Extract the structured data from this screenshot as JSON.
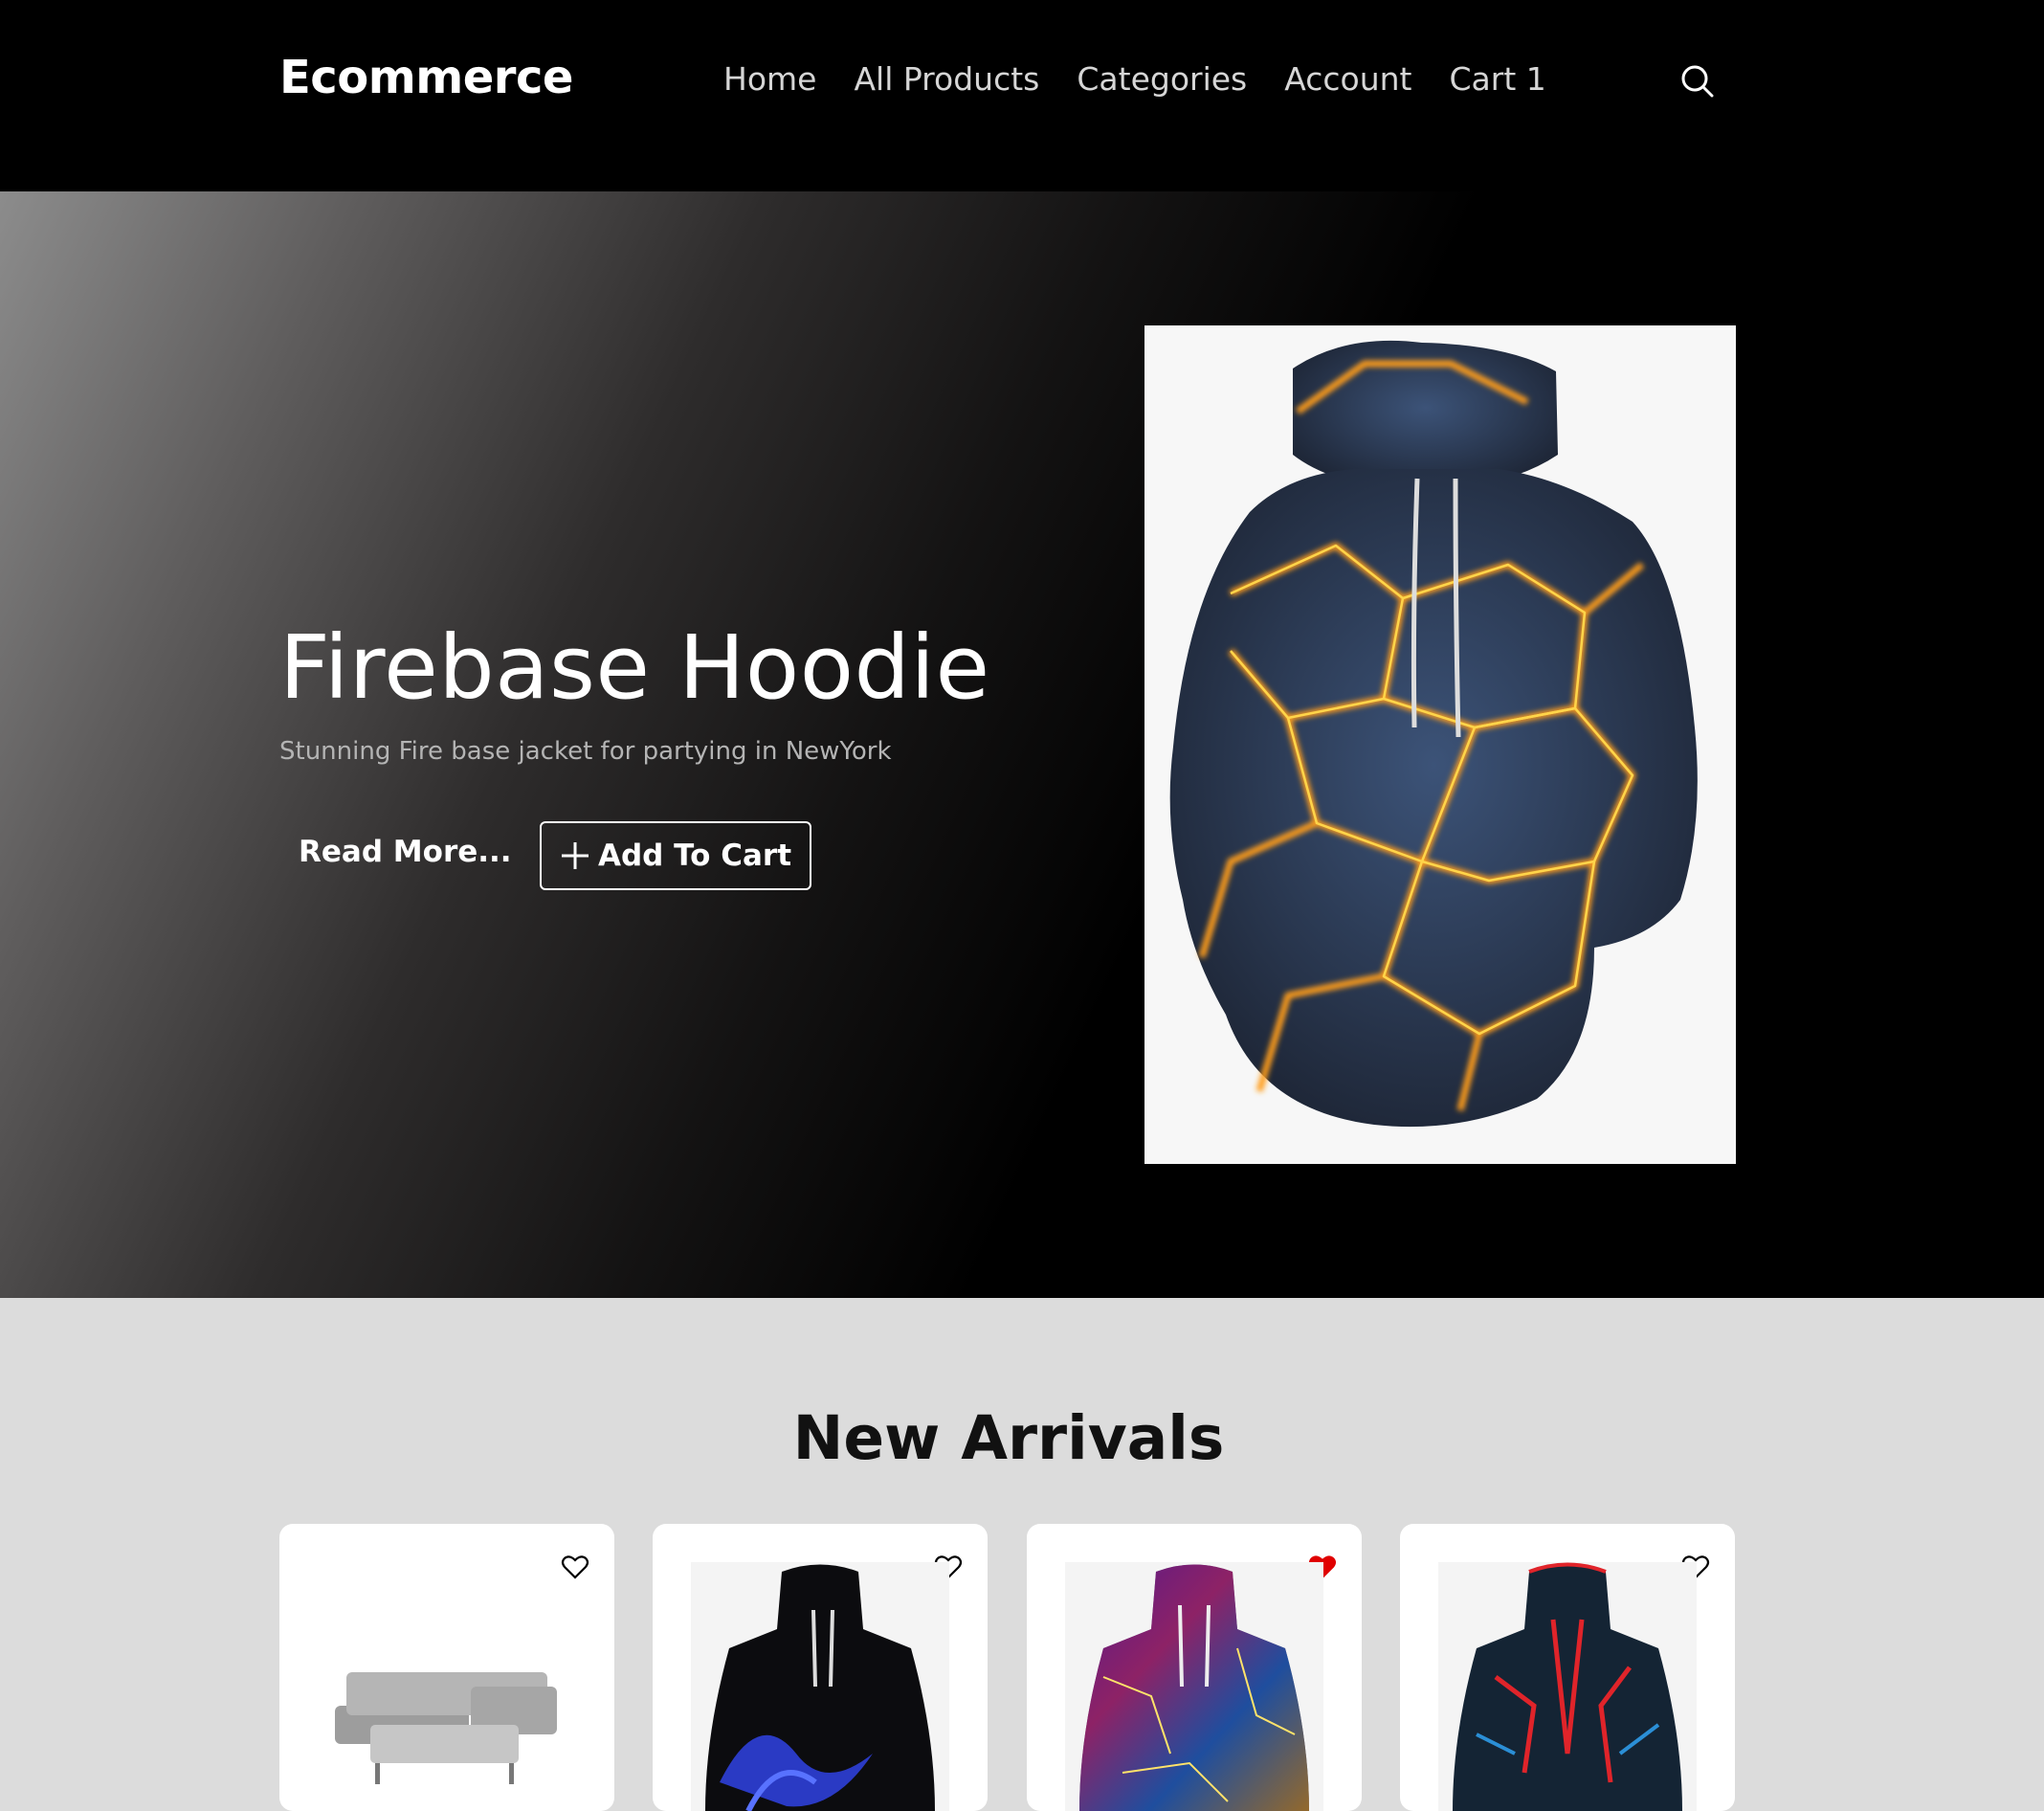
{
  "header": {
    "logo": "Ecommerce",
    "nav": [
      "Home",
      "All Products",
      "Categories",
      "Account",
      "Cart 1"
    ],
    "search_icon": "search-icon"
  },
  "hero": {
    "title": "Firebase Hoodie",
    "subtitle": "Stunning Fire base jacket for partying in NewYork",
    "read_more": "Read More...",
    "add_to_cart": "Add To Cart",
    "add_icon": "plus-icon",
    "image": "orange-glowing-hexagon-hoodie"
  },
  "new_arrivals": {
    "title": "New Arrivals",
    "products": [
      {
        "image": "grey-sofa-with-ottoman",
        "favorited": false
      },
      {
        "image": "black-hoodie-blue-flames",
        "favorited": false
      },
      {
        "image": "neon-circuit-hoodie",
        "favorited": true
      },
      {
        "image": "red-blue-geometric-hoodie",
        "favorited": false
      }
    ]
  },
  "colors": {
    "header_bg": "#000000",
    "section_bg": "#dcdcdc",
    "favorite_active": "#e00000"
  }
}
